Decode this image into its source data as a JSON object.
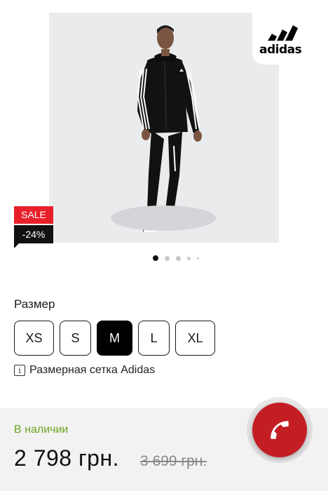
{
  "gallery": {
    "brand_logo_text": "adidas",
    "badge_sale": "SALE",
    "badge_discount": "-24%",
    "dots_count": 5,
    "active_dot": 1
  },
  "size": {
    "title": "Размер",
    "options": [
      "XS",
      "S",
      "M",
      "L",
      "XL"
    ],
    "selected": "M",
    "chart_icon": "info-icon",
    "chart_link": "Размерная сетка Adidas"
  },
  "purchase": {
    "stock_status": "В наличии",
    "price": "2 798 грн.",
    "old_price": "3 699 грн."
  },
  "colors": {
    "sale": "#e8202a",
    "stock": "#6aa51f",
    "call": "#c41e25"
  },
  "call_button_icon": "phone-icon"
}
